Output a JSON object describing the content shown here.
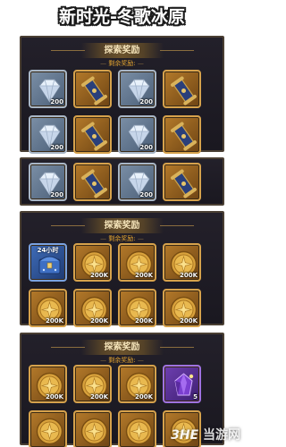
{
  "page": {
    "title": "新时光-冬歌冰原"
  },
  "panels": [
    {
      "header": "探索奖励",
      "remaining_label": "剩余奖励:",
      "items": [
        {
          "icon": "diamond-icon",
          "frame": "silver",
          "qty": "200"
        },
        {
          "icon": "scroll-icon",
          "frame": "bronze",
          "qty": ""
        },
        {
          "icon": "diamond-icon",
          "frame": "silver",
          "qty": "200"
        },
        {
          "icon": "scroll-icon",
          "frame": "bronze",
          "qty": ""
        },
        {
          "icon": "diamond-icon",
          "frame": "silver",
          "qty": "200"
        },
        {
          "icon": "scroll-icon",
          "frame": "bronze",
          "qty": ""
        },
        {
          "icon": "diamond-icon",
          "frame": "silver",
          "qty": "200"
        },
        {
          "icon": "scroll-icon",
          "frame": "bronze",
          "qty": ""
        }
      ]
    },
    {
      "header": "",
      "remaining_label": "",
      "items": [
        {
          "icon": "diamond-icon",
          "frame": "silver",
          "qty": "200"
        },
        {
          "icon": "scroll-icon",
          "frame": "bronze",
          "qty": ""
        },
        {
          "icon": "diamond-icon",
          "frame": "silver",
          "qty": "200"
        },
        {
          "icon": "scroll-icon",
          "frame": "bronze",
          "qty": ""
        }
      ]
    },
    {
      "header": "探索奖励",
      "remaining_label": "剩余奖励:",
      "items": [
        {
          "icon": "chest-icon",
          "frame": "blue",
          "qty": "",
          "tag": "24小时"
        },
        {
          "icon": "coin-icon",
          "frame": "bronze",
          "qty": "200K"
        },
        {
          "icon": "coin-icon",
          "frame": "bronze",
          "qty": "200K"
        },
        {
          "icon": "coin-icon",
          "frame": "bronze",
          "qty": "200K"
        },
        {
          "icon": "coin-icon",
          "frame": "bronze",
          "qty": "200K"
        },
        {
          "icon": "coin-icon",
          "frame": "bronze",
          "qty": "200K"
        },
        {
          "icon": "coin-icon",
          "frame": "bronze",
          "qty": "200K"
        },
        {
          "icon": "coin-icon",
          "frame": "bronze",
          "qty": "200K"
        }
      ]
    },
    {
      "header": "探索奖励",
      "remaining_label": "剩余奖励:",
      "items": [
        {
          "icon": "coin-icon",
          "frame": "bronze",
          "qty": "200K"
        },
        {
          "icon": "coin-icon",
          "frame": "bronze",
          "qty": "200K"
        },
        {
          "icon": "coin-icon",
          "frame": "bronze",
          "qty": "200K"
        },
        {
          "icon": "purple-gem-icon",
          "frame": "purple",
          "qty": "5"
        },
        {
          "icon": "coin-icon",
          "frame": "bronze",
          "qty": ""
        },
        {
          "icon": "coin-icon",
          "frame": "bronze",
          "qty": ""
        },
        {
          "icon": "coin-icon",
          "frame": "bronze",
          "qty": ""
        },
        {
          "icon": "coin-icon",
          "frame": "bronze",
          "qty": ""
        }
      ]
    }
  ],
  "watermark": {
    "logo": "3HE",
    "text": "当游网"
  },
  "colors": {
    "accent": "#e0a22f",
    "panel_bg": "#1d1b22",
    "gold_border": "#d6a24c"
  }
}
